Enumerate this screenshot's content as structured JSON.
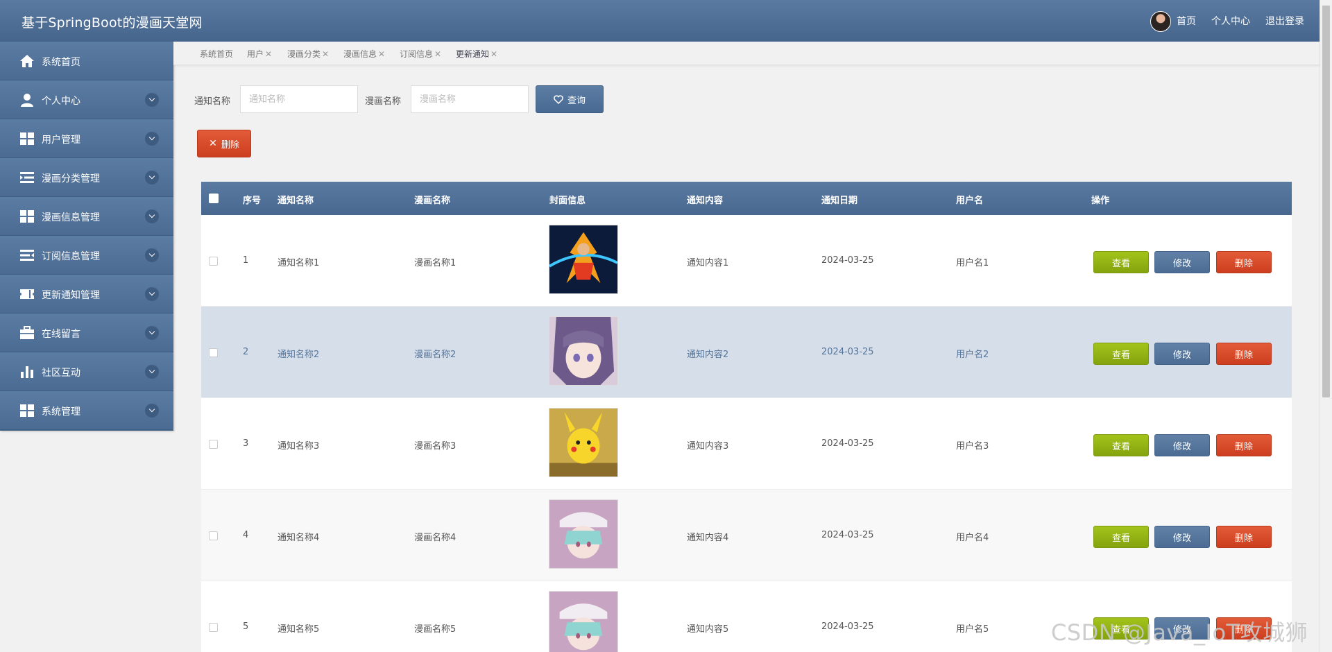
{
  "header": {
    "title": "基于SpringBoot的漫画天堂网",
    "nav": [
      "首页",
      "个人中心",
      "退出登录"
    ]
  },
  "sidebar": {
    "items": [
      {
        "label": "系统首页",
        "icon": "home-icon",
        "expandable": false
      },
      {
        "label": "个人中心",
        "icon": "user-icon",
        "expandable": true
      },
      {
        "label": "用户管理",
        "icon": "grid-icon",
        "expandable": true
      },
      {
        "label": "漫画分类管理",
        "icon": "list-indent-icon",
        "expandable": true
      },
      {
        "label": "漫画信息管理",
        "icon": "grid-icon",
        "expandable": true
      },
      {
        "label": "订阅信息管理",
        "icon": "list-indent-icon",
        "expandable": true
      },
      {
        "label": "更新通知管理",
        "icon": "ticket-icon",
        "expandable": true
      },
      {
        "label": "在线留言",
        "icon": "briefcase-icon",
        "expandable": true
      },
      {
        "label": "社区互动",
        "icon": "bar-chart-icon",
        "expandable": true
      },
      {
        "label": "系统管理",
        "icon": "grid-icon",
        "expandable": true
      }
    ]
  },
  "tabs": [
    {
      "label": "系统首页",
      "closable": false
    },
    {
      "label": "用户",
      "closable": true
    },
    {
      "label": "漫画分类",
      "closable": true
    },
    {
      "label": "漫画信息",
      "closable": true
    },
    {
      "label": "订阅信息",
      "closable": true
    },
    {
      "label": "更新通知",
      "closable": true,
      "active": true
    }
  ],
  "search": {
    "field1_label": "通知名称",
    "field1_placeholder": "通知名称",
    "field2_label": "漫画名称",
    "field2_placeholder": "漫画名称",
    "query_label": "查询",
    "delete_label": "删除"
  },
  "table": {
    "columns": [
      "序号",
      "通知名称",
      "漫画名称",
      "封面信息",
      "通知内容",
      "通知日期",
      "用户名",
      "操作"
    ],
    "rows": [
      {
        "index": "1",
        "notice": "通知名称1",
        "comic": "漫画名称1",
        "content": "通知内容1",
        "date": "2024-03-25",
        "user": "用户名1"
      },
      {
        "index": "2",
        "notice": "通知名称2",
        "comic": "漫画名称2",
        "content": "通知内容2",
        "date": "2024-03-25",
        "user": "用户名2"
      },
      {
        "index": "3",
        "notice": "通知名称3",
        "comic": "漫画名称3",
        "content": "通知内容3",
        "date": "2024-03-25",
        "user": "用户名3"
      },
      {
        "index": "4",
        "notice": "通知名称4",
        "comic": "漫画名称4",
        "content": "通知内容4",
        "date": "2024-03-25",
        "user": "用户名4"
      },
      {
        "index": "5",
        "notice": "通知名称5",
        "comic": "漫画名称5",
        "content": "通知内容5",
        "date": "2024-03-25",
        "user": "用户名5"
      }
    ],
    "actions": {
      "view": "查看",
      "edit": "修改",
      "delete": "删除"
    }
  },
  "watermark": "CSDN @Java_IoT攻城狮",
  "colors": {
    "header": "#5a7aa1",
    "view_button": "#9bbb16",
    "edit_button": "#5677a0",
    "delete_button": "#d9492a"
  }
}
